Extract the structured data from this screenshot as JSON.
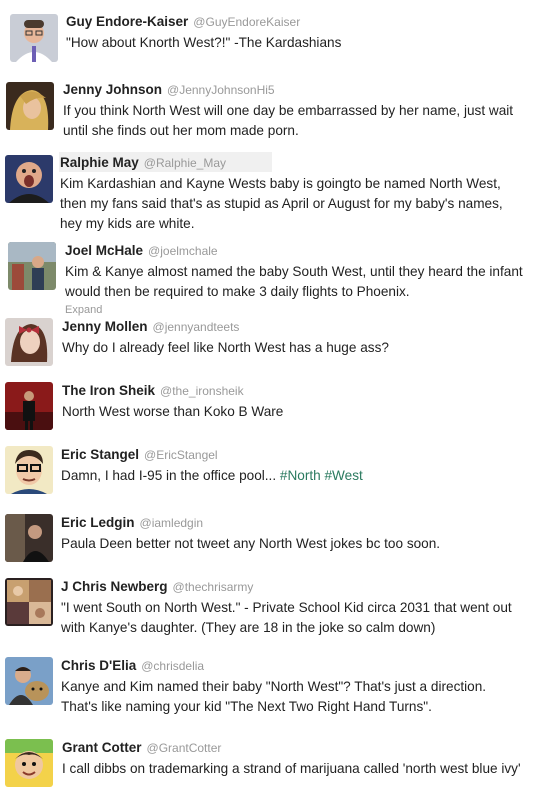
{
  "tweets": [
    {
      "name": "Guy Endore-Kaiser",
      "handle": "@GuyEndoreKaiser",
      "text": "\"How about Knorth West?!\" -The Kardashians",
      "avatar_icon": "man-with-glasses-avatar"
    },
    {
      "name": "Jenny Johnson",
      "handle": "@JennyJohnsonHi5",
      "text": "If you think North West will one day be embarrassed by her name, just wait until she finds out her mom made porn.",
      "avatar_icon": "blonde-woman-avatar"
    },
    {
      "name": "Ralphie May",
      "handle": "@Ralphie_May",
      "text": "Kim Kardashian and Kayne Wests baby is goingto be named North West, then my fans said that's as stupid as April or August for my baby's names, hey my kids are white.",
      "avatar_icon": "comedian-avatar"
    },
    {
      "name": "Joel McHale",
      "handle": "@joelmchale",
      "text": "Kim & Kanye almost named the baby South West, until they heard the infant would then be required to make 3 daily flights to Phoenix.",
      "expand": "Expand",
      "avatar_icon": "man-in-room-avatar"
    },
    {
      "name": "Jenny Mollen",
      "handle": "@jennyandteets",
      "text": "Why do I already feel like North West has a huge ass?",
      "avatar_icon": "woman-with-bow-avatar"
    },
    {
      "name": "The Iron Sheik",
      "handle": "@the_ironsheik",
      "text": "North West worse than Koko B Ware",
      "avatar_icon": "wrestler-avatar"
    },
    {
      "name": "Eric Stangel",
      "handle": "@EricStangel",
      "text_plain": "Damn, I had I-95 in the office pool... ",
      "hashtags": [
        "#North",
        "#West"
      ],
      "avatar_icon": "cartoon-man-avatar"
    },
    {
      "name": "Eric Ledgin",
      "handle": "@iamledgin",
      "text": "Paula Deen better not tweet any North West jokes bc too soon.",
      "avatar_icon": "man-dark-room-avatar"
    },
    {
      "name": "J Chris Newberg",
      "handle": "@thechrisarmy",
      "text": "\"I went South on North West.\" - Private School Kid circa 2031 that went out with Kanye's daughter. (They are 18 in the joke so calm down)",
      "avatar_icon": "photo-collage-avatar"
    },
    {
      "name": "Chris D'Elia",
      "handle": "@chrisdelia",
      "text": "Kanye and Kim named their baby \"North West\"? That's just a direction. That's like naming your kid \"The Next Two Right Hand Turns\".",
      "avatar_icon": "man-with-dog-avatar"
    },
    {
      "name": "Grant Cotter",
      "handle": "@GrantCotter",
      "text": "I call dibbs on trademarking a strand of marijuana called 'north west blue ivy'",
      "avatar_icon": "cartoon-face-avatar"
    }
  ],
  "colors": {
    "hashtag": "#2a7a5f",
    "handle": "#999999",
    "name": "#222222"
  }
}
